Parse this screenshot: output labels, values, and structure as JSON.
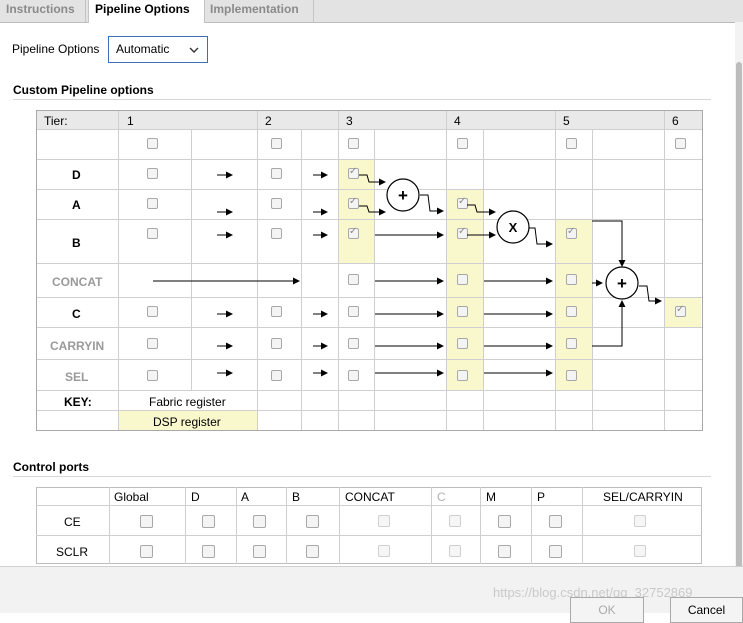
{
  "tabs": [
    {
      "label": "Instructions",
      "active": false
    },
    {
      "label": "Pipeline Options",
      "active": true
    },
    {
      "label": "Implementation",
      "active": false
    }
  ],
  "pipeline_options": {
    "label": "Pipeline Options",
    "value": "Automatic"
  },
  "custom": {
    "title": "Custom Pipeline options",
    "tier_header": "Tier:",
    "tiers": [
      "1",
      "2",
      "3",
      "4",
      "5",
      "6"
    ],
    "rows": [
      "D",
      "A",
      "B",
      "CONCAT",
      "C",
      "CARRYIN",
      "SEL"
    ],
    "key": {
      "label": "KEY:",
      "fabric": "Fabric register",
      "dsp": "DSP register"
    },
    "ops": {
      "add1": "+",
      "mult": "X",
      "add2": "+"
    }
  },
  "control": {
    "title": "Control ports",
    "columns": [
      "Global",
      "D",
      "A",
      "B",
      "CONCAT",
      "C",
      "M",
      "P",
      "SEL/CARRYIN"
    ],
    "rows": [
      "CE",
      "SCLR"
    ]
  },
  "footer": {
    "ok": "OK",
    "cancel": "Cancel",
    "watermark": "https://blog.csdn.net/qq_32752869"
  },
  "colors": {
    "dsp_register": "#f9f7cc",
    "focus_border": "#3d6fb6"
  }
}
